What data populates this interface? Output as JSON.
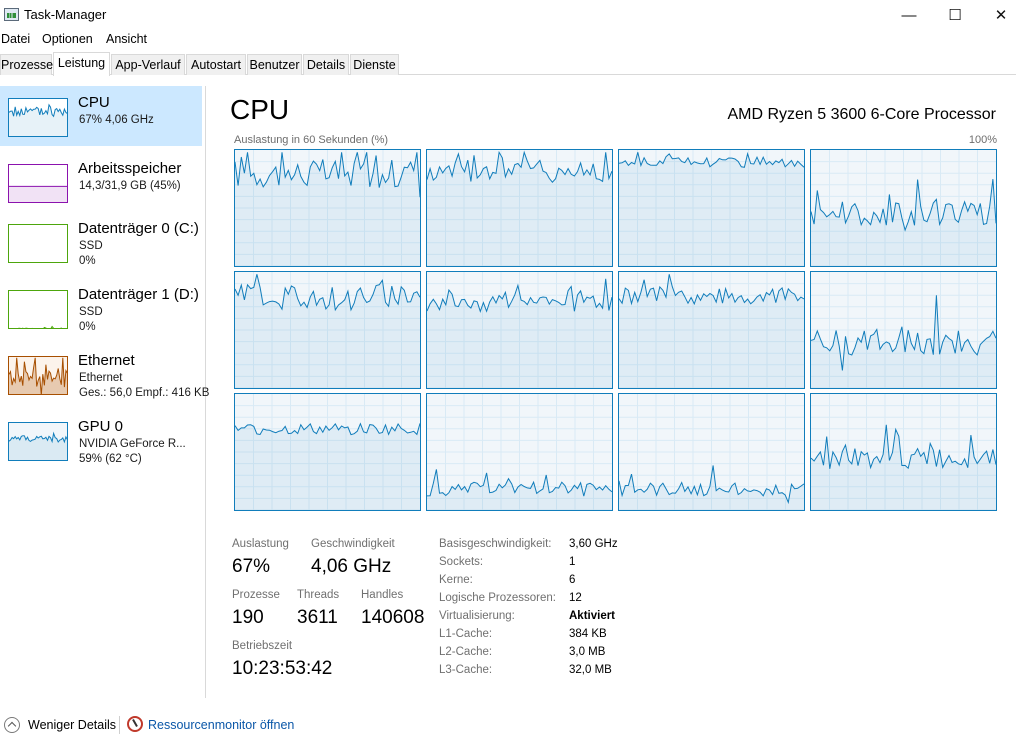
{
  "window": {
    "title": "Task-Manager",
    "minimize_glyph": "—",
    "maximize_glyph": "☐",
    "close_glyph": "✕"
  },
  "menu": [
    "Datei",
    "Optionen",
    "Ansicht"
  ],
  "tabs": [
    "Prozesse",
    "Leistung",
    "App-Verlauf",
    "Autostart",
    "Benutzer",
    "Details",
    "Dienste"
  ],
  "active_tab": "Leistung",
  "sidebar": [
    {
      "title": "CPU",
      "sub1": "67% 4,06 GHz",
      "sub2": "",
      "sub3": "",
      "color": "#117dbb",
      "active": true
    },
    {
      "title": "Arbeitsspeicher",
      "sub1": "14,3/31,9 GB (45%)",
      "sub2": "",
      "sub3": "",
      "color": "#8b12ae"
    },
    {
      "title": "Datenträger 0 (C:)",
      "sub1": "SSD",
      "sub2": "0%",
      "sub3": "",
      "color": "#4da60c"
    },
    {
      "title": "Datenträger 1 (D:)",
      "sub1": "SSD",
      "sub2": "0%",
      "sub3": "",
      "color": "#4da60c"
    },
    {
      "title": "Ethernet",
      "sub1": "Ethernet",
      "sub2": "Ges.: 56,0  Empf.: 416 KB",
      "sub3": "",
      "color": "#a74f01"
    },
    {
      "title": "GPU 0",
      "sub1": "NVIDIA GeForce R...",
      "sub2": "59% (62 °C)",
      "sub3": "",
      "color": "#117dbb"
    }
  ],
  "main": {
    "title": "CPU",
    "model": "AMD Ryzen 5 3600 6-Core Processor",
    "graph_label": "Auslastung in 60 Sekunden (%)",
    "graph_max": "100%",
    "graph_color": "#117dbb",
    "graph_fill": "#f1f6fa",
    "stats": {
      "auslastung_label": "Auslastung",
      "auslastung_value": "67%",
      "geschwindigkeit_label": "Geschwindigkeit",
      "geschwindigkeit_value": "4,06 GHz",
      "prozesse_label": "Prozesse",
      "prozesse_value": "190",
      "threads_label": "Threads",
      "threads_value": "3611",
      "handles_label": "Handles",
      "handles_value": "140608",
      "betriebszeit_label": "Betriebszeit",
      "betriebszeit_value": "10:23:53:42"
    },
    "details": [
      {
        "label": "Basisgeschwindigkeit:",
        "value": "3,60 GHz"
      },
      {
        "label": "Sockets:",
        "value": "1"
      },
      {
        "label": "Kerne:",
        "value": "6"
      },
      {
        "label": "Logische Prozessoren:",
        "value": "12"
      },
      {
        "label": "Virtualisierung:",
        "value": "Aktiviert",
        "bold": true
      },
      {
        "label": "L1-Cache:",
        "value": "384 KB"
      },
      {
        "label": "L2-Cache:",
        "value": "3,0 MB"
      },
      {
        "label": "L3-Cache:",
        "value": "32,0 MB"
      }
    ]
  },
  "footer": {
    "fewer_details": "Weniger Details",
    "resource_monitor": "Ressourcenmonitor öffnen"
  }
}
